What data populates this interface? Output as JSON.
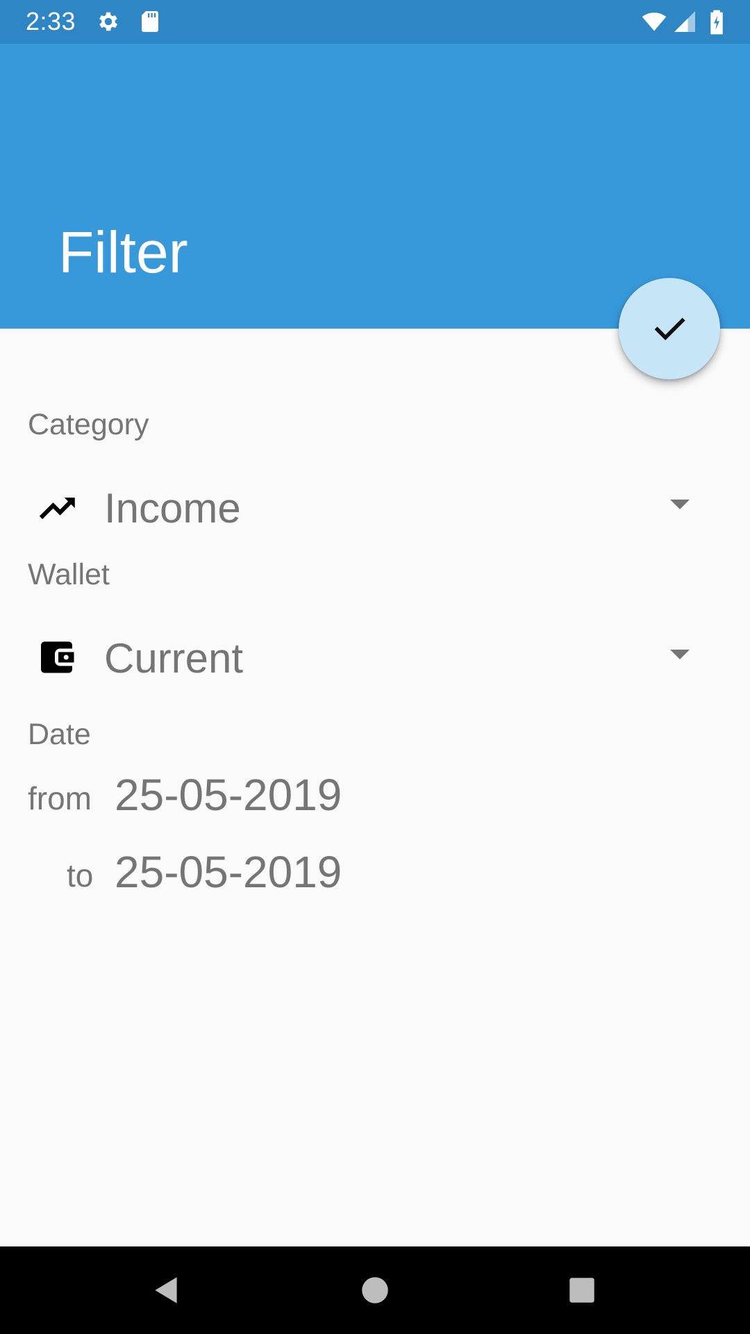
{
  "status_bar": {
    "time": "2:33",
    "icons": [
      "gear-icon",
      "sd-card-icon",
      "wifi-icon",
      "signal-icon",
      "battery-charging-icon"
    ]
  },
  "app_bar": {
    "title": "Filter",
    "color": "#3798da"
  },
  "fab": {
    "icon": "check-icon",
    "color": "#c6e6f8"
  },
  "form": {
    "category": {
      "label": "Category",
      "icon": "trending-up-icon",
      "value": "Income"
    },
    "wallet": {
      "label": "Wallet",
      "icon": "wallet-icon",
      "value": "Current"
    },
    "date": {
      "label": "Date",
      "from_label": "from",
      "from_value": "25-05-2019",
      "to_label": "to",
      "to_value": "25-05-2019"
    }
  },
  "nav_bar": {
    "icons": [
      "back-icon",
      "home-icon",
      "recents-icon"
    ]
  }
}
